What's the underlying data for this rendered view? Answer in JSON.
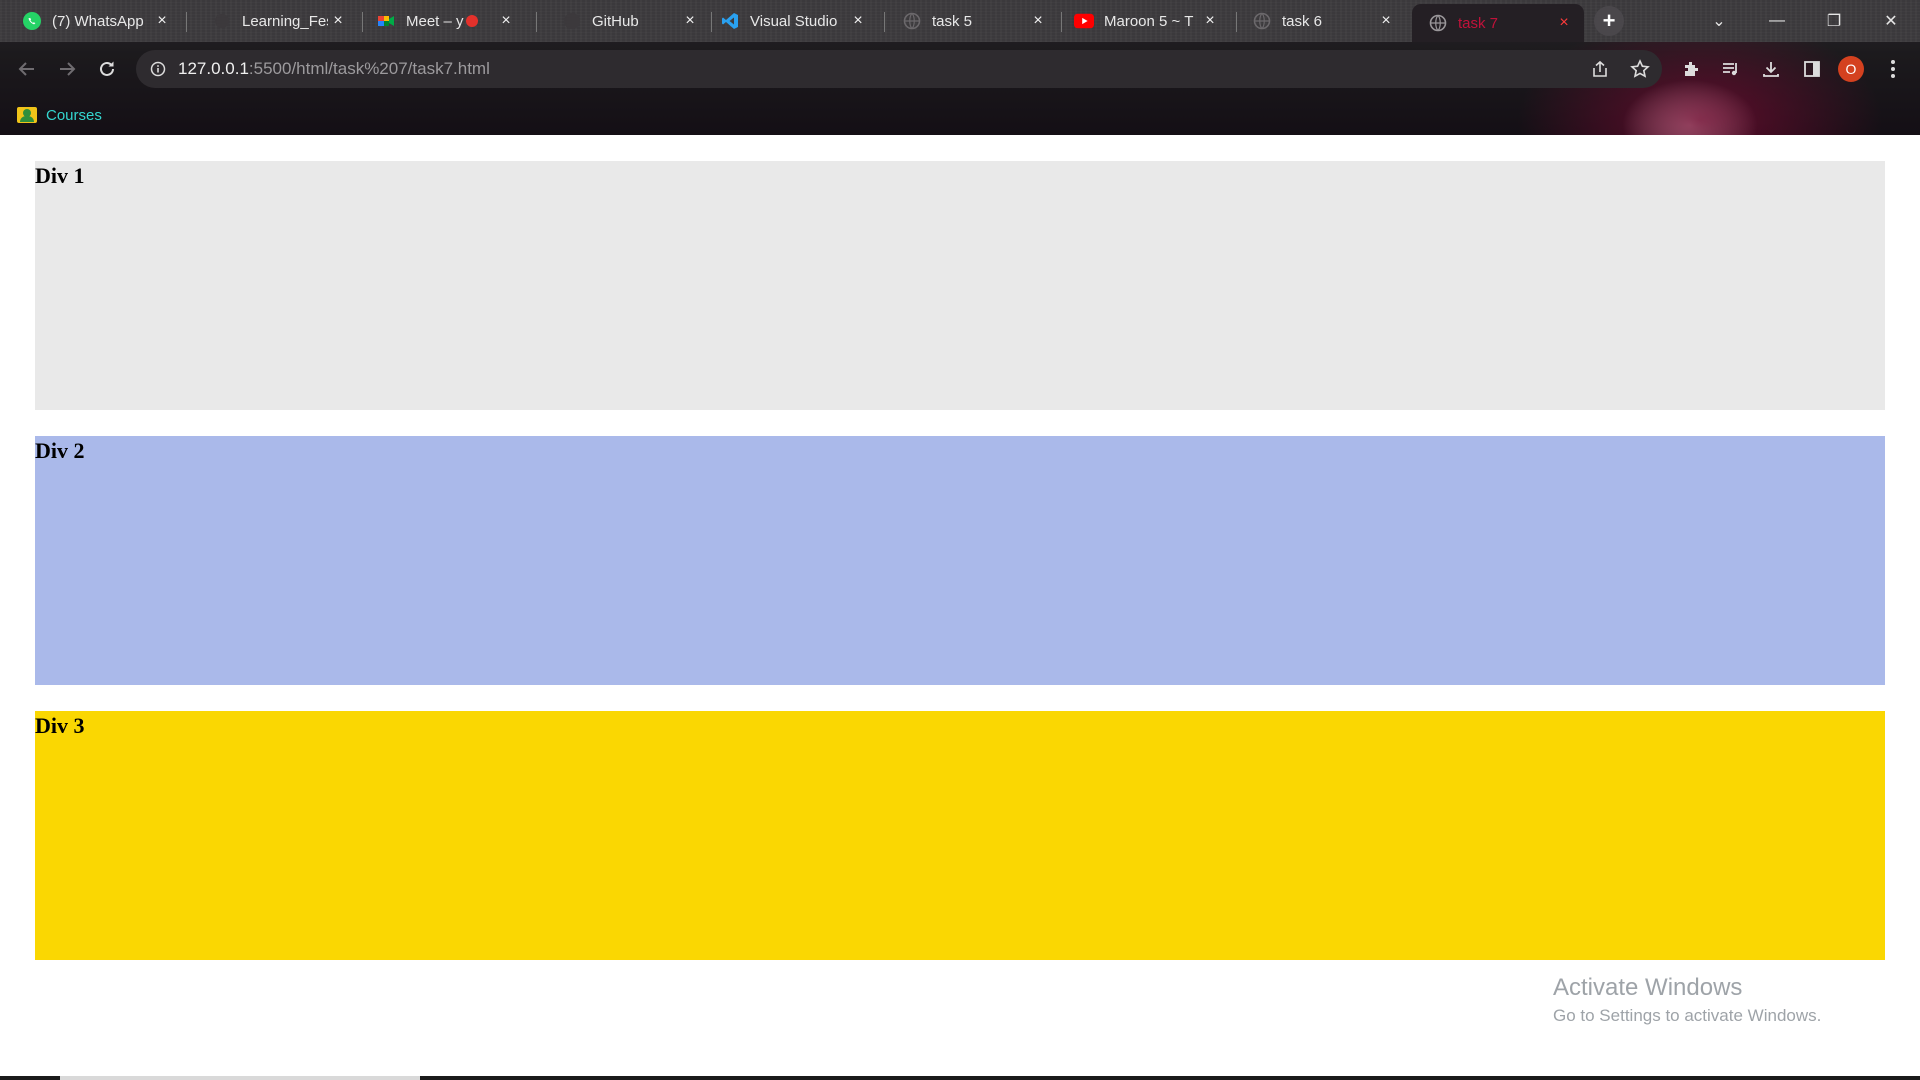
{
  "browser": {
    "tabs": [
      {
        "title": "(7) WhatsApp",
        "icon": "whatsapp-icon",
        "close": "×"
      },
      {
        "title": "Learning_Fes",
        "icon": "blank-page-icon",
        "close": "×"
      },
      {
        "title": "Meet – y",
        "icon": "google-meet-icon",
        "close": "×"
      },
      {
        "title": "GitHub",
        "icon": "github-icon",
        "close": "×"
      },
      {
        "title": "Visual Studio",
        "icon": "vscode-icon",
        "close": "×"
      },
      {
        "title": "task 5",
        "icon": "globe-icon",
        "close": "×"
      },
      {
        "title": "Maroon 5 ~ T",
        "icon": "youtube-icon",
        "close": "×"
      },
      {
        "title": "task 6",
        "icon": "globe-icon",
        "close": "×"
      },
      {
        "title": "task 7",
        "icon": "globe-icon",
        "close": "×",
        "active": true
      }
    ],
    "new_tab": "+",
    "window_controls": {
      "tab_search": "⌄",
      "minimize": "—",
      "restore": "❐",
      "close": "✕"
    },
    "address": {
      "host": "127.0.0.1",
      "rest": ":5500/html/task%207/task7.html"
    },
    "profile_initial": "O",
    "bookmarks": [
      {
        "label": "Courses",
        "icon": "google-classroom-icon"
      }
    ],
    "accent_color": "#c0123a"
  },
  "page": {
    "divs": [
      {
        "heading": "Div 1",
        "color": "#e9e9e9"
      },
      {
        "heading": "Div 2",
        "color": "#aab9ea"
      },
      {
        "heading": "Div 3",
        "color": "#fad702"
      }
    ]
  },
  "watermark": {
    "line1": "Activate Windows",
    "line2": "Go to Settings to activate Windows."
  }
}
